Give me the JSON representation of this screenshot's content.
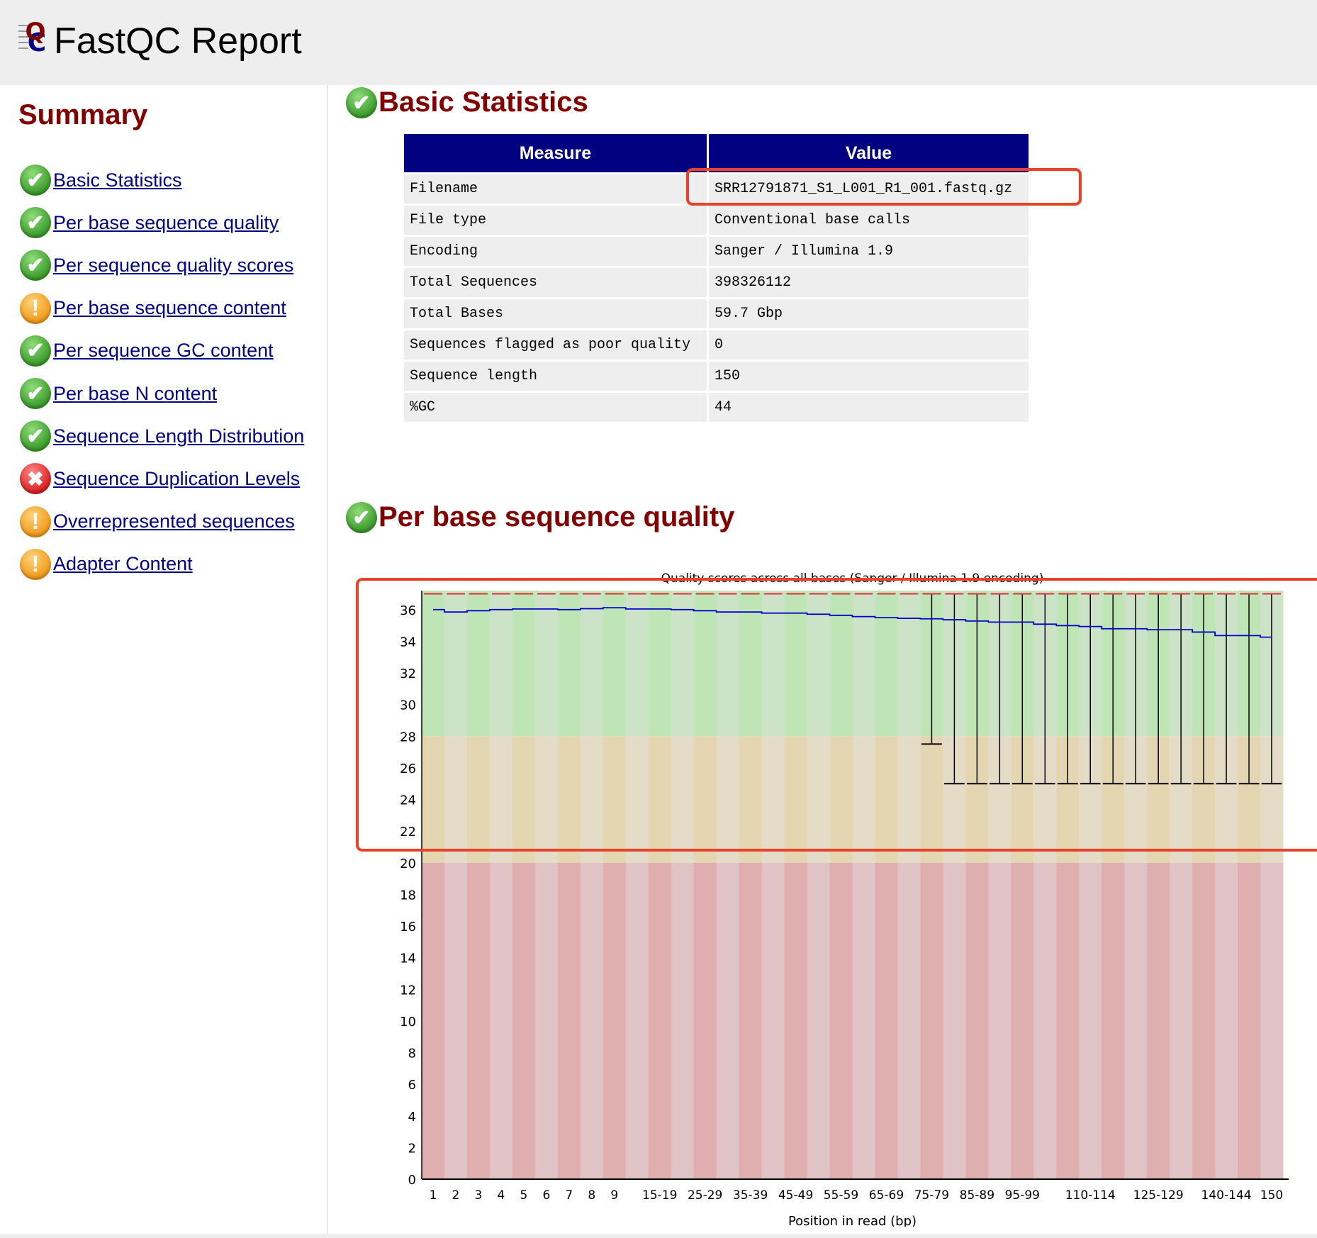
{
  "header": {
    "title": "FastQC Report",
    "logo": "fastqc-logo"
  },
  "sidebar": {
    "title": "Summary",
    "items": [
      {
        "label": "Basic Statistics",
        "status": "pass"
      },
      {
        "label": "Per base sequence quality",
        "status": "pass"
      },
      {
        "label": "Per sequence quality scores",
        "status": "pass"
      },
      {
        "label": "Per base sequence content",
        "status": "warn"
      },
      {
        "label": "Per sequence GC content",
        "status": "pass"
      },
      {
        "label": "Per base N content",
        "status": "pass"
      },
      {
        "label": "Sequence Length Distribution",
        "status": "pass"
      },
      {
        "label": "Sequence Duplication Levels",
        "status": "fail"
      },
      {
        "label": "Overrepresented sequences",
        "status": "warn"
      },
      {
        "label": "Adapter Content",
        "status": "warn"
      }
    ]
  },
  "status_icons": {
    "pass": "check-circle-icon",
    "warn": "exclamation-circle-icon",
    "fail": "x-circle-icon"
  },
  "basic_stats": {
    "title": "Basic Statistics",
    "status": "pass",
    "headers": [
      "Measure",
      "Value"
    ],
    "rows": [
      [
        "Filename",
        "SRR12791871_S1_L001_R1_001.fastq.gz"
      ],
      [
        "File type",
        "Conventional base calls"
      ],
      [
        "Encoding",
        "Sanger / Illumina 1.9"
      ],
      [
        "Total Sequences",
        "398326112"
      ],
      [
        "Total Bases",
        "59.7 Gbp"
      ],
      [
        "Sequences flagged as poor quality",
        "0"
      ],
      [
        "Sequence length",
        "150"
      ],
      [
        "%GC",
        "44"
      ]
    ]
  },
  "per_base_quality": {
    "title": "Per base sequence quality",
    "status": "pass"
  },
  "colors": {
    "accent": "#800000",
    "table_header": "#000080",
    "link": "#000080",
    "annotation": "#e8412c",
    "mean_line": "#0000cc",
    "median": "#e03030"
  },
  "chart_data": {
    "type": "box",
    "title": "Quality scores across all bases (Sanger / Illumina 1.9 encoding)",
    "xlabel": "Position in read (bp)",
    "ylabel": "",
    "ylim": [
      0,
      37.2
    ],
    "yticks": [
      0,
      2,
      4,
      6,
      8,
      10,
      12,
      14,
      16,
      18,
      20,
      22,
      24,
      26,
      28,
      30,
      32,
      34,
      36
    ],
    "categories": [
      "1",
      "2",
      "3",
      "4",
      "5",
      "6",
      "7",
      "8",
      "9",
      "10-14",
      "15-19",
      "20-24",
      "25-29",
      "30-34",
      "35-39",
      "40-44",
      "45-49",
      "50-54",
      "55-59",
      "60-64",
      "65-69",
      "70-74",
      "75-79",
      "80-84",
      "85-89",
      "90-94",
      "95-99",
      "100-104",
      "105-109",
      "110-114",
      "115-119",
      "120-124",
      "125-129",
      "130-134",
      "135-139",
      "140-144",
      "145-149",
      "150"
    ],
    "xtick_labels_shown": [
      "1",
      "2",
      "3",
      "4",
      "5",
      "6",
      "7",
      "8",
      "9",
      "15-19",
      "25-29",
      "35-39",
      "45-49",
      "55-59",
      "65-69",
      "75-79",
      "85-89",
      "95-99",
      "110-114",
      "125-129",
      "140-144",
      "150"
    ],
    "mean": [
      36.0,
      35.85,
      35.93,
      36.0,
      36.04,
      36.04,
      36.0,
      36.06,
      36.12,
      36.04,
      36.04,
      36.0,
      35.93,
      35.85,
      35.85,
      35.78,
      35.78,
      35.71,
      35.64,
      35.56,
      35.49,
      35.45,
      35.42,
      35.36,
      35.28,
      35.21,
      35.21,
      35.08,
      34.99,
      34.93,
      34.79,
      34.79,
      34.73,
      34.73,
      34.58,
      34.36,
      34.36,
      34.26
    ],
    "median": [
      37,
      37,
      37,
      37,
      37,
      37,
      37,
      37,
      37,
      37,
      37,
      37,
      37,
      37,
      37,
      37,
      37,
      37,
      37,
      37,
      37,
      37,
      37,
      37,
      37,
      37,
      37,
      37,
      37,
      37,
      37,
      37,
      37,
      37,
      37,
      37,
      37,
      37
    ],
    "upper_whisker": [
      37,
      37,
      37,
      37,
      37,
      37,
      37,
      37,
      37,
      37,
      37,
      37,
      37,
      37,
      37,
      37,
      37,
      37,
      37,
      37,
      37,
      37,
      37,
      37,
      37,
      37,
      37,
      37,
      37,
      37,
      37,
      37,
      37,
      37,
      37,
      37,
      37,
      37
    ],
    "lower_whisker": [
      37,
      37,
      37,
      37,
      37,
      37,
      37,
      37,
      37,
      37,
      37,
      37,
      37,
      37,
      37,
      37,
      37,
      37,
      37,
      37,
      37,
      37,
      27.5,
      25,
      25,
      25,
      25,
      25,
      25,
      25,
      25,
      25,
      25,
      25,
      25,
      25,
      25,
      25
    ],
    "zones": [
      {
        "name": "good",
        "from": 28,
        "to": 37.2,
        "colors": [
          "#bfe4b5",
          "#cde3c8"
        ]
      },
      {
        "name": "reasonable",
        "from": 20,
        "to": 28,
        "colors": [
          "#e5d6b2",
          "#e5dcc8"
        ]
      },
      {
        "name": "poor",
        "from": 0,
        "to": 20,
        "colors": [
          "#dfaeae",
          "#e0c3c4"
        ]
      }
    ],
    "grid": false,
    "legend": "none"
  }
}
